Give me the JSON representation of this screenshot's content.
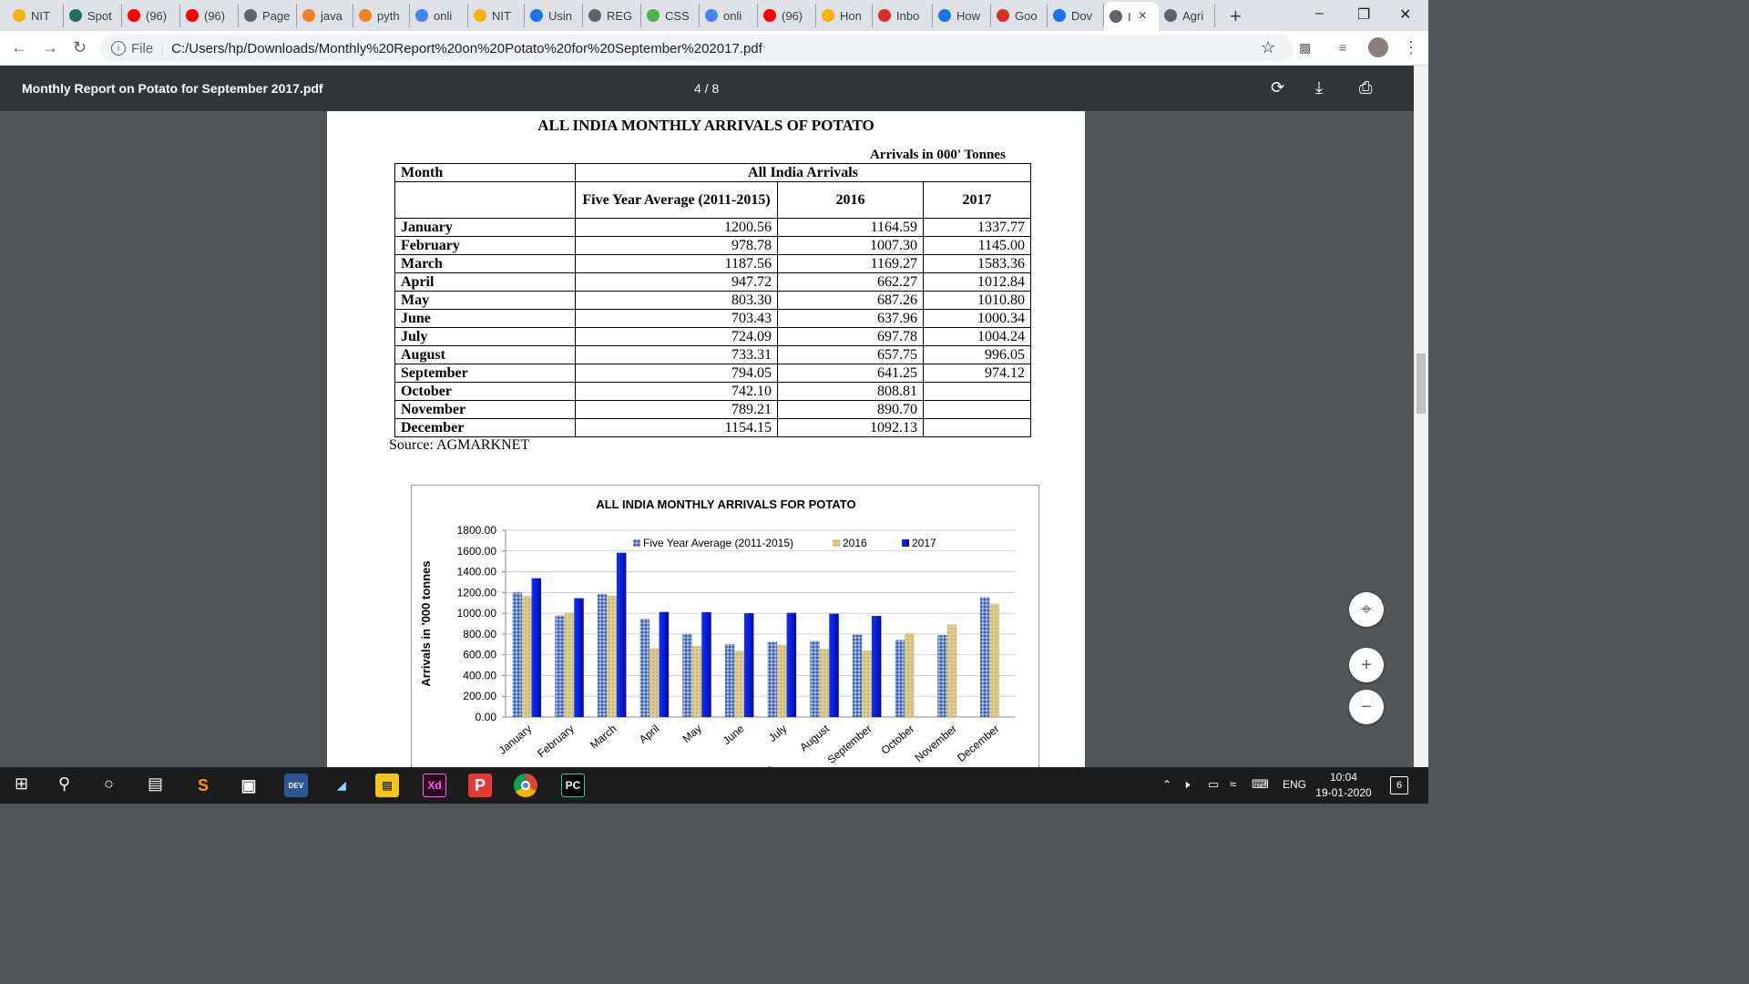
{
  "tabs": [
    {
      "label": "NIT",
      "icon": "nit-icon",
      "color": "#f4b400"
    },
    {
      "label": "Spot",
      "icon": "spotify-icon",
      "color": "#1e6f5c"
    },
    {
      "label": "(96)",
      "icon": "youtube-icon",
      "color": "#ff0000"
    },
    {
      "label": "(96)",
      "icon": "youtube-icon",
      "color": "#ff0000"
    },
    {
      "label": "Page",
      "icon": "globe-icon",
      "color": "#5f6368"
    },
    {
      "label": "java",
      "icon": "stack-icon",
      "color": "#f48024"
    },
    {
      "label": "pyth",
      "icon": "stack-icon",
      "color": "#f48024"
    },
    {
      "label": "onli",
      "icon": "google-icon",
      "color": "#4285f4"
    },
    {
      "label": "NIT",
      "icon": "nit-icon",
      "color": "#f4b400"
    },
    {
      "label": "Usin",
      "icon": "w3-icon",
      "color": "#1a73e8"
    },
    {
      "label": "REG",
      "icon": "globe-icon",
      "color": "#5f6368"
    },
    {
      "label": "CSS",
      "icon": "w3schools-icon",
      "color": "#4caf50"
    },
    {
      "label": "onli",
      "icon": "google-icon",
      "color": "#4285f4"
    },
    {
      "label": "(96)",
      "icon": "youtube-icon",
      "color": "#ff0000"
    },
    {
      "label": "Hon",
      "icon": "trophy-icon",
      "color": "#f4b400"
    },
    {
      "label": "Inbo",
      "icon": "gmail-icon",
      "color": "#d93025"
    },
    {
      "label": "How",
      "icon": "w3-icon",
      "color": "#1a73e8"
    },
    {
      "label": "Goo",
      "icon": "gmail-icon",
      "color": "#d93025"
    },
    {
      "label": "Dov",
      "icon": "download-icon",
      "color": "#1a73e8"
    },
    {
      "label": "I",
      "icon": "globe-icon",
      "color": "#5f6368"
    },
    {
      "label": "Agri",
      "icon": "globe-icon",
      "color": "#5f6368"
    }
  ],
  "address": {
    "scheme_label": "File",
    "url": "C:/Users/hp/Downloads/Monthly%20Report%20on%20Potato%20for%20September%202017.pdf"
  },
  "pdf": {
    "title": "Monthly Report on Potato for September 2017.pdf",
    "page_indicator": "4 / 8"
  },
  "document": {
    "heading": "ALL INDIA MONTHLY ARRIVALS OF POTATO",
    "unit_note": "Arrivals in 000' Tonnes",
    "table": {
      "col_month": "Month",
      "col_group": "All India Arrivals",
      "col_avg": "Five Year Average (2011-2015)",
      "col_2016": "2016",
      "col_2017": "2017",
      "rows": [
        {
          "month": "January",
          "avg": "1200.56",
          "y2016": "1164.59",
          "y2017": "1337.77"
        },
        {
          "month": "February",
          "avg": "978.78",
          "y2016": "1007.30",
          "y2017": "1145.00"
        },
        {
          "month": "March",
          "avg": "1187.56",
          "y2016": "1169.27",
          "y2017": "1583.36"
        },
        {
          "month": "April",
          "avg": "947.72",
          "y2016": "662.27",
          "y2017": "1012.84"
        },
        {
          "month": "May",
          "avg": "803.30",
          "y2016": "687.26",
          "y2017": "1010.80"
        },
        {
          "month": "June",
          "avg": "703.43",
          "y2016": "637.96",
          "y2017": "1000.34"
        },
        {
          "month": "July",
          "avg": "724.09",
          "y2016": "697.78",
          "y2017": "1004.24"
        },
        {
          "month": "August",
          "avg": "733.31",
          "y2016": "657.75",
          "y2017": "996.05"
        },
        {
          "month": "September",
          "avg": "794.05",
          "y2016": "641.25",
          "y2017": "974.12"
        },
        {
          "month": "October",
          "avg": "742.10",
          "y2016": "808.81",
          "y2017": ""
        },
        {
          "month": "November",
          "avg": "789.21",
          "y2016": "890.70",
          "y2017": ""
        },
        {
          "month": "December",
          "avg": "1154.15",
          "y2016": "1092.13",
          "y2017": ""
        }
      ]
    },
    "source": "Source: AGMARKNET"
  },
  "chart_data": {
    "type": "bar",
    "title": "ALL INDIA MONTHLY ARRIVALS FOR POTATO",
    "xlabel": "Months",
    "ylabel": "Arrivals in '000 tonnes",
    "ylim": [
      0,
      1800
    ],
    "yticks": [
      "0.00",
      "200.00",
      "400.00",
      "600.00",
      "800.00",
      "1000.00",
      "1200.00",
      "1400.00",
      "1600.00",
      "1800.00"
    ],
    "grid": true,
    "legend_position": "top-center",
    "categories": [
      "January",
      "February",
      "March",
      "April",
      "May",
      "June",
      "July",
      "August",
      "September",
      "October",
      "November",
      "December"
    ],
    "series": [
      {
        "name": "Five Year Average (2011-2015)",
        "color": "#6f8fc9",
        "values": [
          1200.56,
          978.78,
          1187.56,
          947.72,
          803.3,
          703.43,
          724.09,
          733.31,
          794.05,
          742.1,
          789.21,
          1154.15
        ]
      },
      {
        "name": "2016",
        "color": "#dccb8c",
        "values": [
          1164.59,
          1007.3,
          1169.27,
          662.27,
          687.26,
          637.96,
          697.78,
          657.75,
          641.25,
          808.81,
          890.7,
          1092.13
        ]
      },
      {
        "name": "2017",
        "color": "#0a1ed6",
        "values": [
          1337.77,
          1145.0,
          1583.36,
          1012.84,
          1010.8,
          1000.34,
          1004.24,
          996.05,
          974.12,
          null,
          null,
          null
        ]
      }
    ]
  },
  "taskbar": {
    "lang": "ENG",
    "time": "10:04",
    "date": "19-01-2020",
    "notifications": "6"
  }
}
